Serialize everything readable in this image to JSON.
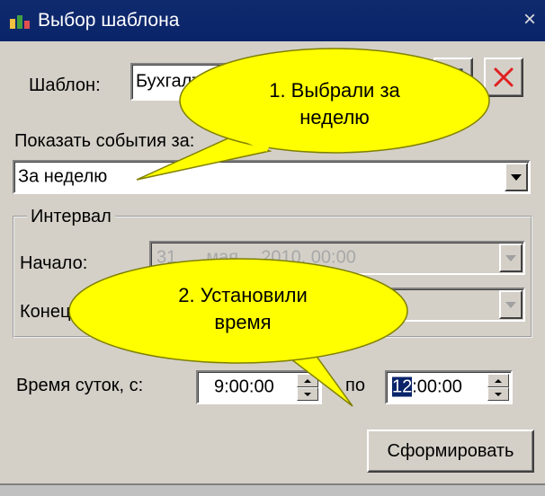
{
  "window": {
    "title": "Выбор шаблона",
    "close": "×"
  },
  "template": {
    "label": "Шаблон:",
    "value": "Бухгалтерия"
  },
  "show_events": {
    "label": "Показать события за:",
    "value": "За неделю"
  },
  "interval": {
    "legend": "Интервал",
    "start_label": "Начало:",
    "start_day": "31",
    "start_month": "мая",
    "start_rest": "2010, 00:00",
    "end_label": "Конец:"
  },
  "time_of_day": {
    "label": "Время суток, с:",
    "from": "9:00:00",
    "to_label": "по",
    "to_selected": "12",
    "to_rest": ":00:00"
  },
  "generate_button": "Сформировать",
  "callouts": [
    {
      "text_line1": "1. Выбрали за",
      "text_line2": "неделю"
    },
    {
      "text_line1": "2. Установили",
      "text_line2": "время"
    }
  ],
  "colors": {
    "titlebar": "#0a246a",
    "callout_fill": "#ffff00",
    "delete_red": "#e02020"
  }
}
